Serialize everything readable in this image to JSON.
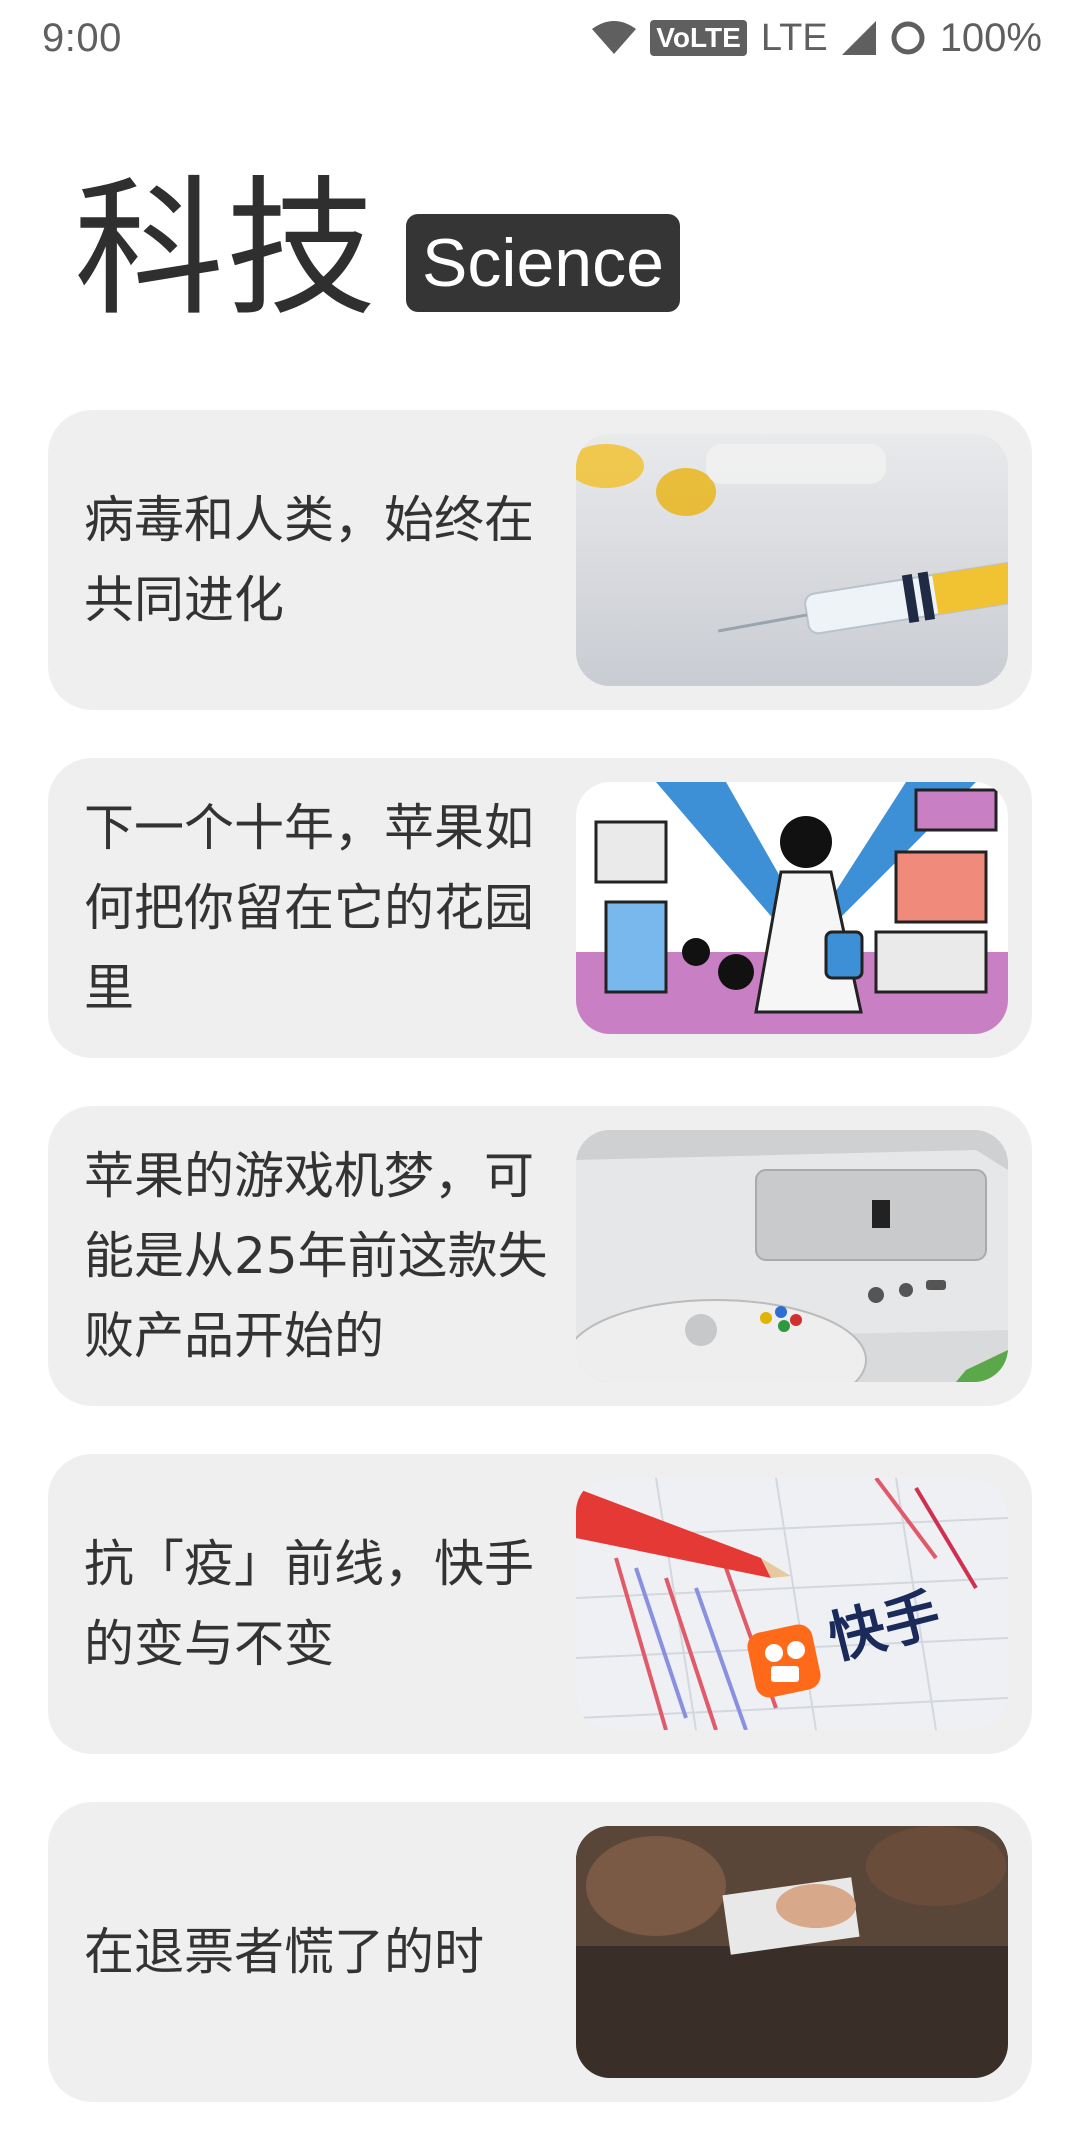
{
  "status_bar": {
    "time": "9:00",
    "volte": "VoLTE",
    "network": "LTE",
    "battery": "100%",
    "icons": [
      "wifi-icon",
      "signal-icon",
      "battery-icon"
    ]
  },
  "header": {
    "title": "科技",
    "badge": "Science"
  },
  "articles": [
    {
      "title": "病毒和人类，始终在共同进化",
      "image": "syringe-photo"
    },
    {
      "title": "下一个十年，苹果如何把你留在它的花园里",
      "image": "illustration-app-store"
    },
    {
      "title": "苹果的游戏机梦，可能是从25年前这款失败产品开始的",
      "image": "pippin-console-photo"
    },
    {
      "title": "抗「疫」前线，快手的变与不变",
      "image": "kuaishou-chart-photo",
      "image_text": "快手"
    },
    {
      "title": "在退票者慌了的时",
      "image": "ticket-photo"
    }
  ],
  "colors": {
    "background": "#ffffff",
    "card": "#efefef",
    "badge": "#353535",
    "text": "#2f2f2f"
  }
}
